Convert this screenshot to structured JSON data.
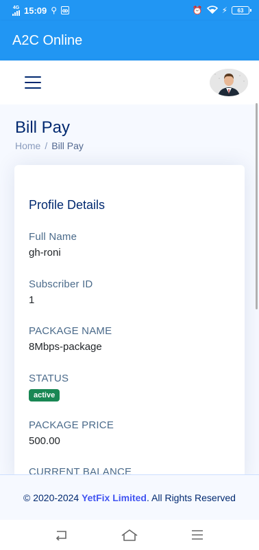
{
  "status_bar": {
    "network": "4G",
    "time": "15:09",
    "battery": "63",
    "icons": [
      "usb-icon",
      "vpn-icon",
      "alarm-icon",
      "wifi-icon",
      "charging-icon",
      "battery-icon"
    ]
  },
  "app_bar": {
    "title": "A2C Online"
  },
  "header": {
    "menu_icon": "hamburger-menu-icon",
    "avatar_icon": "user-avatar"
  },
  "page": {
    "title": "Bill Pay",
    "breadcrumb": {
      "home": "Home",
      "separator": "/",
      "current": "Bill Pay"
    }
  },
  "profile": {
    "title": "Profile Details",
    "full_name_label": "Full Name",
    "full_name": "gh-roni",
    "subscriber_id_label": "Subscriber ID",
    "subscriber_id": "1",
    "package_name_label": "PACKAGE NAME",
    "package_name": "8Mbps-package",
    "status_label": "STATUS",
    "status": "active",
    "package_price_label": "PACKAGE PRICE",
    "package_price": "500.00",
    "current_balance_label": "CURRENT BALANCE"
  },
  "footer": {
    "prefix": "© 2020-2024 ",
    "brand": "YetFix Limited",
    "suffix": ". All Rights Reserved"
  },
  "nav": {
    "icons": [
      "back-icon",
      "home-icon",
      "recents-icon"
    ]
  },
  "colors": {
    "primary": "#2196f3",
    "navy": "#012970",
    "success": "#198754",
    "brand": "#4154f1"
  }
}
